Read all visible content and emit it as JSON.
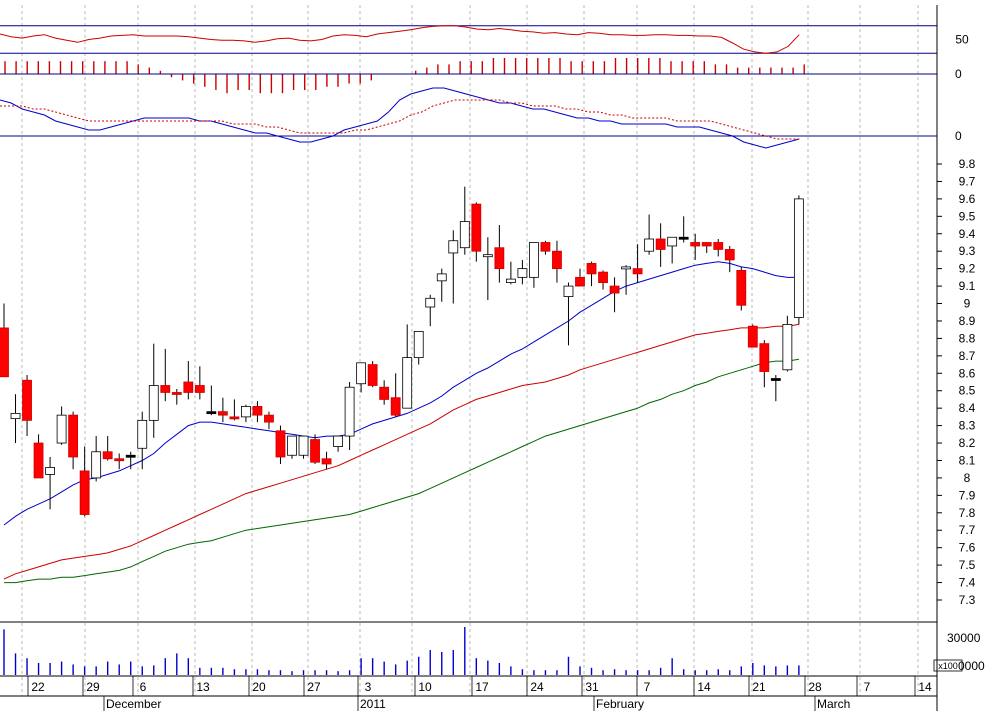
{
  "chart_data": [
    {
      "type": "line",
      "panel": "oscillator",
      "ylim": [
        0,
        100
      ],
      "tick_labels": [
        "50"
      ],
      "reference_levels": [
        30,
        70
      ],
      "values": [
        58,
        54,
        52,
        55,
        57,
        52,
        49,
        46,
        50,
        52,
        55,
        56,
        57,
        55,
        55,
        55,
        55,
        54,
        52,
        50,
        49,
        49,
        48,
        46,
        48,
        51,
        52,
        49,
        48,
        50,
        55,
        57,
        56,
        54,
        58,
        60,
        62,
        64,
        67,
        69,
        70,
        70,
        68,
        65,
        64,
        66,
        64,
        62,
        61,
        59,
        60,
        58,
        57,
        60,
        59,
        57,
        57,
        56,
        56,
        57,
        57,
        56,
        56,
        55,
        55,
        53,
        45,
        36,
        32,
        30,
        32,
        40,
        57
      ],
      "colors": {
        "line": "#cc0000",
        "levels": "#00008b"
      }
    },
    {
      "type": "bar",
      "panel": "histogram",
      "tick_labels": [
        "0"
      ],
      "values": [
        4,
        4,
        4,
        4,
        4,
        4,
        4,
        4,
        4,
        4,
        4,
        4,
        3,
        2,
        1,
        -1,
        -2,
        -3,
        -4,
        -5,
        -6,
        -5,
        -5,
        -6,
        -6,
        -6,
        -5,
        -5,
        -5,
        -4,
        -4,
        -3,
        -3,
        -2,
        0,
        0,
        0,
        1,
        2,
        3,
        3,
        4,
        4,
        4,
        5,
        5,
        5,
        5,
        5,
        5,
        5,
        4,
        4,
        4,
        4,
        5,
        5,
        5,
        5,
        5,
        4,
        4,
        4,
        4,
        3,
        3,
        2,
        2,
        2,
        2,
        2,
        2,
        3
      ],
      "colors": {
        "bar": "#cc0000",
        "zero": "#00008b"
      }
    },
    {
      "type": "line",
      "panel": "macd",
      "tick_labels": [
        "0"
      ],
      "series": [
        {
          "values": [
            0.12,
            0.11,
            0.09,
            0.08,
            0.07,
            0.05,
            0.04,
            0.03,
            0.02,
            0.02,
            0.03,
            0.04,
            0.05,
            0.06,
            0.06,
            0.06,
            0.06,
            0.06,
            0.05,
            0.05,
            0.04,
            0.03,
            0.02,
            0.01,
            0.01,
            0.0,
            -0.01,
            -0.02,
            -0.02,
            -0.01,
            0.0,
            0.02,
            0.03,
            0.04,
            0.05,
            0.08,
            0.12,
            0.14,
            0.15,
            0.16,
            0.16,
            0.15,
            0.14,
            0.13,
            0.12,
            0.11,
            0.11,
            0.1,
            0.09,
            0.09,
            0.08,
            0.07,
            0.06,
            0.06,
            0.05,
            0.05,
            0.04,
            0.04,
            0.04,
            0.04,
            0.04,
            0.03,
            0.03,
            0.03,
            0.02,
            0.01,
            0.0,
            -0.02,
            -0.03,
            -0.04,
            -0.03,
            -0.02,
            -0.01
          ],
          "color": "#0000cc",
          "dash": false
        },
        {
          "values": [
            0.1,
            0.1,
            0.1,
            0.09,
            0.09,
            0.08,
            0.07,
            0.06,
            0.05,
            0.05,
            0.05,
            0.05,
            0.05,
            0.05,
            0.05,
            0.05,
            0.05,
            0.05,
            0.05,
            0.05,
            0.05,
            0.04,
            0.04,
            0.04,
            0.03,
            0.03,
            0.02,
            0.01,
            0.01,
            0.01,
            0.01,
            0.01,
            0.02,
            0.02,
            0.03,
            0.04,
            0.05,
            0.07,
            0.08,
            0.1,
            0.11,
            0.12,
            0.12,
            0.12,
            0.12,
            0.12,
            0.11,
            0.11,
            0.1,
            0.1,
            0.1,
            0.09,
            0.09,
            0.08,
            0.08,
            0.07,
            0.07,
            0.06,
            0.06,
            0.06,
            0.06,
            0.05,
            0.05,
            0.05,
            0.05,
            0.04,
            0.03,
            0.02,
            0.01,
            0.0,
            -0.01,
            -0.01,
            -0.01
          ],
          "color": "#cc0000",
          "dash": true
        }
      ]
    },
    {
      "type": "candlestick",
      "panel": "price",
      "ylim": [
        7.2,
        9.85
      ],
      "y_ticks": [
        7.3,
        7.4,
        7.5,
        7.6,
        7.7,
        7.8,
        7.9,
        8.0,
        8.1,
        8.2,
        8.3,
        8.4,
        8.5,
        8.6,
        8.7,
        8.8,
        8.9,
        9.0,
        9.1,
        9.2,
        9.3,
        9.4,
        9.5,
        9.6,
        9.7,
        9.8
      ],
      "candles": [
        [
          8.86,
          9.0,
          8.58,
          8.58
        ],
        [
          8.34,
          8.48,
          8.2,
          8.37
        ],
        [
          8.56,
          8.59,
          8.24,
          8.33
        ],
        [
          8.2,
          8.25,
          8.02,
          8.0
        ],
        [
          8.02,
          8.12,
          7.82,
          8.06
        ],
        [
          8.2,
          8.41,
          8.19,
          8.36
        ],
        [
          8.36,
          8.38,
          8.05,
          8.12
        ],
        [
          8.04,
          8.18,
          7.78,
          7.79
        ],
        [
          8.0,
          8.24,
          7.98,
          8.15
        ],
        [
          8.15,
          8.24,
          8.1,
          8.11
        ],
        [
          8.11,
          8.14,
          8.05,
          8.1
        ],
        [
          8.13,
          8.15,
          8.05,
          8.13
        ],
        [
          8.17,
          8.38,
          8.05,
          8.33
        ],
        [
          8.33,
          8.77,
          8.23,
          8.53
        ],
        [
          8.53,
          8.74,
          8.44,
          8.49
        ],
        [
          8.49,
          8.51,
          8.42,
          8.48
        ],
        [
          8.55,
          8.67,
          8.45,
          8.49
        ],
        [
          8.53,
          8.64,
          8.45,
          8.49
        ],
        [
          8.38,
          8.53,
          8.36,
          8.38
        ],
        [
          8.38,
          8.46,
          8.32,
          8.36
        ],
        [
          8.35,
          8.45,
          8.33,
          8.34
        ],
        [
          8.35,
          8.42,
          8.32,
          8.41
        ],
        [
          8.41,
          8.44,
          8.32,
          8.36
        ],
        [
          8.36,
          8.38,
          8.28,
          8.32
        ],
        [
          8.27,
          8.3,
          8.08,
          8.12
        ],
        [
          8.13,
          8.24,
          8.11,
          8.24
        ],
        [
          8.13,
          8.24,
          8.11,
          8.24
        ],
        [
          8.22,
          8.25,
          8.08,
          8.09
        ],
        [
          8.11,
          8.15,
          8.05,
          8.08
        ],
        [
          8.18,
          8.24,
          8.15,
          8.24
        ],
        [
          8.24,
          8.55,
          8.16,
          8.52
        ],
        [
          8.54,
          8.66,
          8.49,
          8.66
        ],
        [
          8.65,
          8.67,
          8.52,
          8.53
        ],
        [
          8.52,
          8.56,
          8.42,
          8.45
        ],
        [
          8.46,
          8.6,
          8.35,
          8.36
        ],
        [
          8.4,
          8.88,
          8.4,
          8.69
        ],
        [
          8.69,
          8.82,
          8.65,
          8.84
        ],
        [
          8.98,
          9.05,
          8.87,
          9.03
        ],
        [
          9.13,
          9.2,
          9.01,
          9.17
        ],
        [
          9.29,
          9.42,
          9.0,
          9.36
        ],
        [
          9.32,
          9.67,
          9.28,
          9.47
        ],
        [
          9.57,
          9.58,
          9.24,
          9.3
        ],
        [
          9.27,
          9.38,
          9.02,
          9.28
        ],
        [
          9.32,
          9.45,
          9.12,
          9.2
        ],
        [
          9.12,
          9.24,
          9.11,
          9.14
        ],
        [
          9.15,
          9.25,
          9.11,
          9.2
        ],
        [
          9.15,
          9.33,
          9.09,
          9.35
        ],
        [
          9.35,
          9.36,
          9.28,
          9.3
        ],
        [
          9.3,
          9.36,
          9.12,
          9.2
        ],
        [
          9.04,
          9.12,
          8.76,
          9.1
        ],
        [
          9.15,
          9.2,
          9.1,
          9.1
        ],
        [
          9.23,
          9.24,
          9.1,
          9.17
        ],
        [
          9.18,
          9.19,
          9.08,
          9.12
        ],
        [
          9.1,
          9.15,
          8.95,
          9.06
        ],
        [
          9.2,
          9.22,
          9.05,
          9.21
        ],
        [
          9.2,
          9.34,
          9.12,
          9.17
        ],
        [
          9.3,
          9.51,
          9.28,
          9.37
        ],
        [
          9.37,
          9.46,
          9.21,
          9.31
        ],
        [
          9.33,
          9.35,
          9.23,
          9.38
        ],
        [
          9.38,
          9.5,
          9.35,
          9.38
        ],
        [
          9.35,
          9.4,
          9.25,
          9.33
        ],
        [
          9.35,
          9.33,
          9.29,
          9.33
        ],
        [
          9.35,
          9.37,
          9.27,
          9.31
        ],
        [
          9.31,
          9.33,
          9.18,
          9.25
        ],
        [
          9.19,
          9.21,
          8.96,
          8.99
        ],
        [
          8.87,
          8.88,
          8.79,
          8.75
        ],
        [
          8.77,
          8.79,
          8.52,
          8.61
        ],
        [
          8.57,
          8.59,
          8.44,
          8.57
        ],
        [
          8.62,
          8.93,
          8.61,
          8.88
        ],
        [
          8.92,
          9.62,
          8.88,
          9.6
        ]
      ],
      "ma_series": [
        {
          "color": "#0000cc",
          "values": [
            7.73,
            7.78,
            7.82,
            7.85,
            7.88,
            7.92,
            7.96,
            7.99,
            8.0,
            8.02,
            8.04,
            8.07,
            8.1,
            8.14,
            8.2,
            8.25,
            8.3,
            8.32,
            8.32,
            8.31,
            8.3,
            8.29,
            8.28,
            8.27,
            8.26,
            8.25,
            8.24,
            8.23,
            8.24,
            8.24,
            8.25,
            8.28,
            8.31,
            8.33,
            8.35,
            8.37,
            8.4,
            8.43,
            8.47,
            8.52,
            8.56,
            8.6,
            8.63,
            8.67,
            8.71,
            8.74,
            8.78,
            8.82,
            8.86,
            8.9,
            8.95,
            8.99,
            9.03,
            9.07,
            9.1,
            9.12,
            9.14,
            9.16,
            9.18,
            9.2,
            9.22,
            9.23,
            9.24,
            9.23,
            9.21,
            9.2,
            9.18,
            9.16,
            9.15,
            9.15
          ]
        },
        {
          "color": "#cc0000",
          "values": [
            7.42,
            7.45,
            7.47,
            7.49,
            7.51,
            7.53,
            7.54,
            7.55,
            7.56,
            7.57,
            7.59,
            7.61,
            7.64,
            7.67,
            7.7,
            7.73,
            7.76,
            7.79,
            7.82,
            7.85,
            7.88,
            7.91,
            7.93,
            7.95,
            7.97,
            7.99,
            8.01,
            8.03,
            8.05,
            8.07,
            8.1,
            8.13,
            8.16,
            8.19,
            8.22,
            8.25,
            8.28,
            8.31,
            8.35,
            8.39,
            8.42,
            8.45,
            8.47,
            8.49,
            8.51,
            8.53,
            8.54,
            8.55,
            8.57,
            8.59,
            8.62,
            8.64,
            8.66,
            8.68,
            8.7,
            8.72,
            8.74,
            8.76,
            8.78,
            8.8,
            8.82,
            8.83,
            8.84,
            8.85,
            8.86,
            8.86,
            8.86,
            8.87,
            8.87,
            8.88
          ]
        },
        {
          "color": "#006600",
          "values": [
            7.4,
            7.4,
            7.41,
            7.42,
            7.42,
            7.43,
            7.43,
            7.44,
            7.45,
            7.46,
            7.47,
            7.49,
            7.52,
            7.55,
            7.58,
            7.6,
            7.62,
            7.63,
            7.64,
            7.66,
            7.68,
            7.7,
            7.71,
            7.72,
            7.73,
            7.74,
            7.75,
            7.76,
            7.77,
            7.78,
            7.79,
            7.81,
            7.83,
            7.85,
            7.87,
            7.89,
            7.91,
            7.94,
            7.97,
            8.0,
            8.03,
            8.06,
            8.09,
            8.12,
            8.15,
            8.18,
            8.21,
            8.24,
            8.26,
            8.28,
            8.3,
            8.32,
            8.34,
            8.36,
            8.38,
            8.4,
            8.43,
            8.45,
            8.48,
            8.5,
            8.53,
            8.55,
            8.58,
            8.6,
            8.62,
            8.64,
            8.66,
            8.67,
            8.67,
            8.68
          ]
        }
      ],
      "colors": {
        "up_fill": "#ffffff",
        "down_fill": "#ff0000",
        "neutral_fill": "#000000",
        "wick": "#000000"
      }
    },
    {
      "type": "bar",
      "panel": "volume",
      "tick_labels": [
        "30000",
        "0000"
      ],
      "unit_label": "x100",
      "values": [
        0.95,
        0.45,
        0.35,
        0.25,
        0.25,
        0.28,
        0.22,
        0.18,
        0.18,
        0.28,
        0.22,
        0.28,
        0.18,
        0.2,
        0.35,
        0.45,
        0.35,
        0.15,
        0.15,
        0.15,
        0.12,
        0.12,
        0.12,
        0.1,
        0.1,
        0.08,
        0.1,
        0.1,
        0.1,
        0.08,
        0.1,
        0.35,
        0.35,
        0.28,
        0.22,
        0.3,
        0.38,
        0.52,
        0.48,
        0.52,
        1.0,
        0.35,
        0.3,
        0.25,
        0.18,
        0.12,
        0.1,
        0.1,
        0.1,
        0.38,
        0.18,
        0.15,
        0.1,
        0.12,
        0.1,
        0.1,
        0.1,
        0.15,
        0.35,
        0.12,
        0.1,
        0.1,
        0.12,
        0.1,
        0.18,
        0.25,
        0.2,
        0.18,
        0.2,
        0.2
      ],
      "colors": {
        "bar": "#0000cc"
      }
    }
  ],
  "x_axis": {
    "day_labels": [
      "22",
      "29",
      "6",
      "13",
      "20",
      "27",
      "3",
      "10",
      "17",
      "24",
      "31",
      "7",
      "14",
      "21",
      "28",
      "7",
      "14"
    ],
    "month_labels": [
      "December",
      "2011",
      "February",
      "March"
    ]
  }
}
